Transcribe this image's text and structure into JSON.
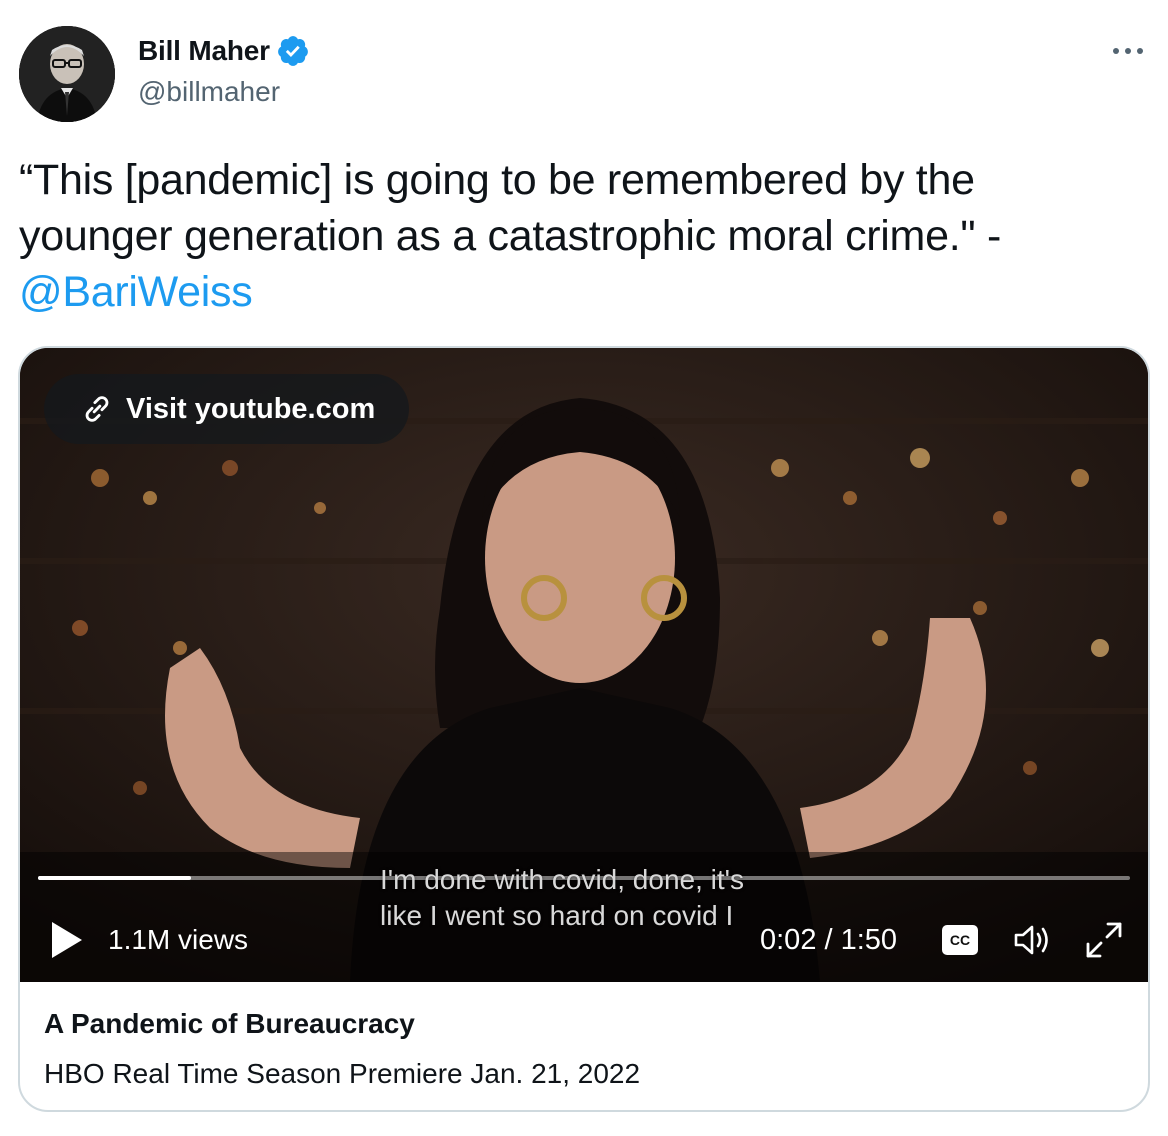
{
  "author": {
    "display_name": "Bill Maher",
    "handle": "@billmaher",
    "verified": true,
    "avatar_icon": "profile-photo"
  },
  "tweet": {
    "text_line1": "“This [pandemic] is going to be remembered by the",
    "text_line2": "younger generation as a catastrophic moral crime.\" -",
    "mention": "@BariWeiss"
  },
  "card": {
    "visit_label": "Visit youtube.com",
    "views": "1.1M views",
    "caption_line1": "I'm done with covid, done, it's",
    "caption_line2": "like I went so hard on covid I",
    "time": "0:02 / 1:50",
    "cc_label": "CC",
    "progress": 0.018,
    "title": "A Pandemic of Bureaucracy",
    "description": "HBO Real Time Season Premiere Jan. 21, 2022"
  },
  "icons": {
    "verified": "verified-badge-icon",
    "more": "more-icon",
    "link": "link-icon",
    "play": "play-icon",
    "volume": "volume-icon",
    "fullscreen": "fullscreen-icon"
  },
  "colors": {
    "accent": "#1d9bf0",
    "text": "#0f1419",
    "secondary": "#536471",
    "border": "#cfd9de"
  }
}
